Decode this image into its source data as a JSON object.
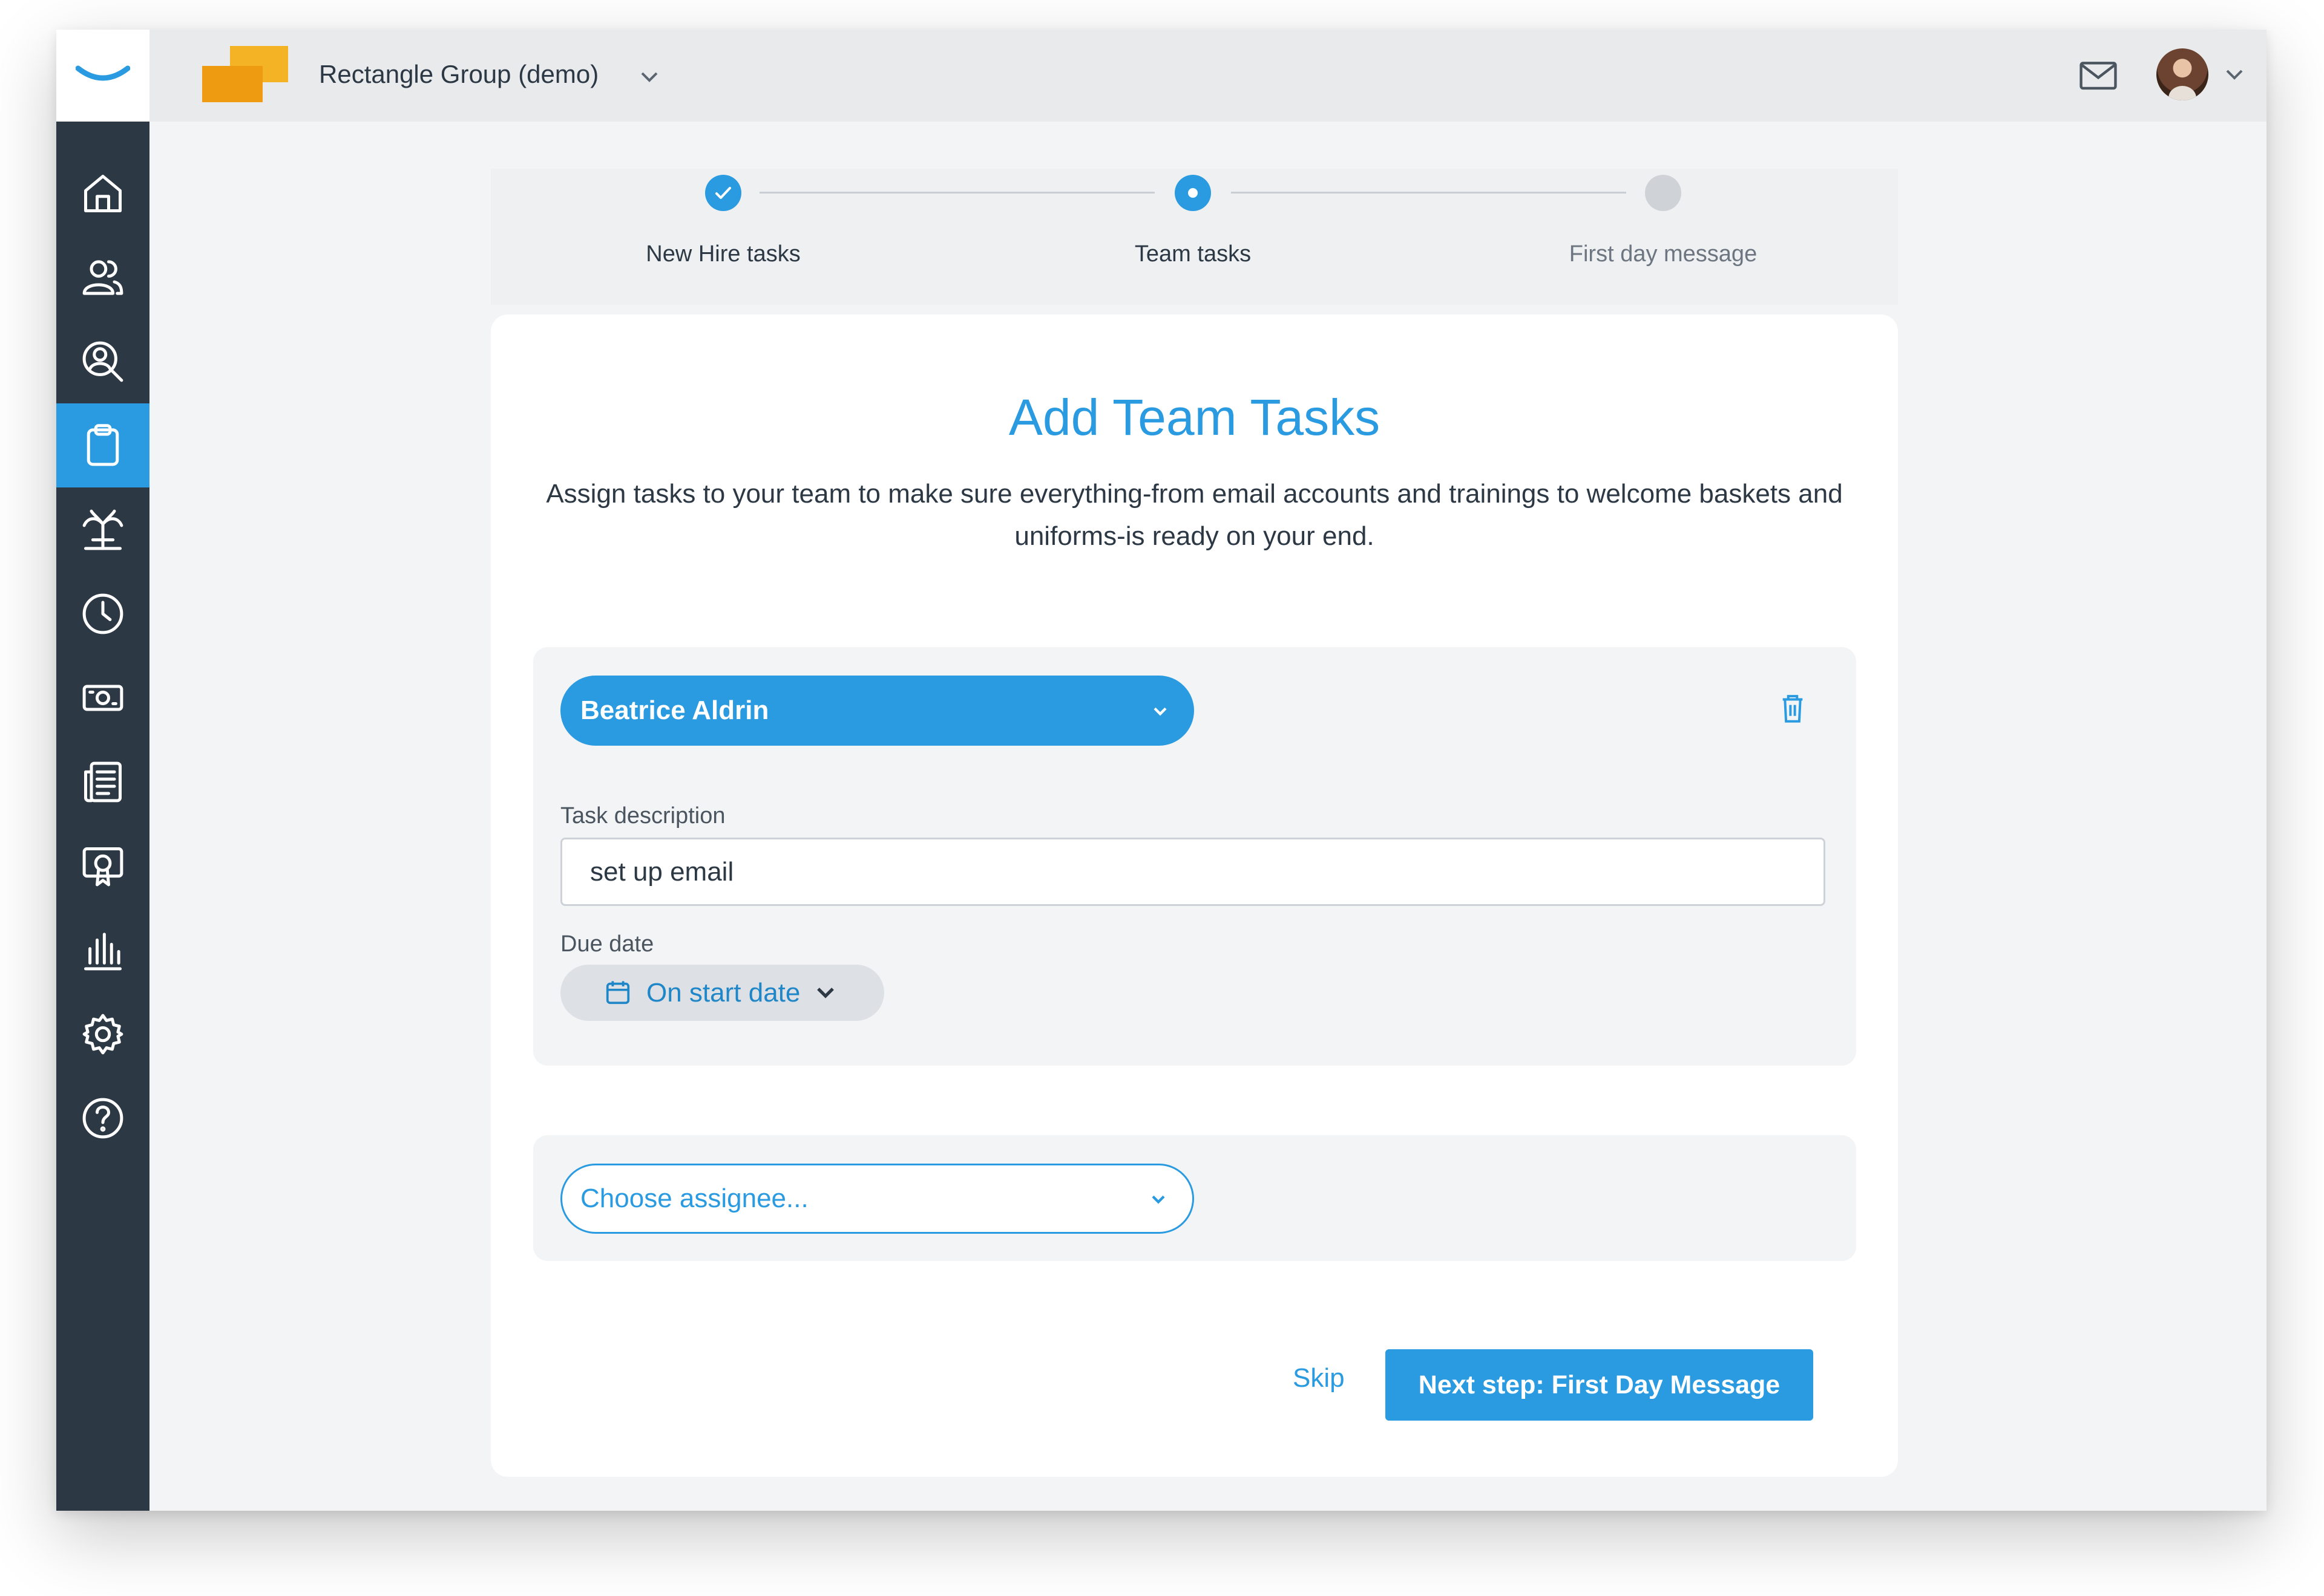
{
  "app": {
    "company_name": "Rectangle Group (demo)",
    "brand_color": "#2a9be0",
    "sidebar_color": "#2d3845"
  },
  "sidebar": {
    "items": [
      {
        "icon": "home-icon",
        "active": false
      },
      {
        "icon": "people-icon",
        "active": false
      },
      {
        "icon": "recruiting-icon",
        "active": false
      },
      {
        "icon": "onboarding-clipboard-icon",
        "active": true
      },
      {
        "icon": "time-off-icon",
        "active": false
      },
      {
        "icon": "clock-icon",
        "active": false
      },
      {
        "icon": "payroll-icon",
        "active": false
      },
      {
        "icon": "documents-icon",
        "active": false
      },
      {
        "icon": "certificate-icon",
        "active": false
      },
      {
        "icon": "reports-icon",
        "active": false
      },
      {
        "icon": "settings-icon",
        "active": false
      },
      {
        "icon": "help-icon",
        "active": false
      }
    ]
  },
  "stepper": {
    "steps": [
      {
        "label": "New Hire tasks",
        "state": "done"
      },
      {
        "label": "Team tasks",
        "state": "current"
      },
      {
        "label": "First day message",
        "state": "todo"
      }
    ]
  },
  "card": {
    "title": "Add Team Tasks",
    "description": "Assign tasks to your team to make sure everything-from email accounts and trainings to welcome baskets and uniforms-is ready on your end."
  },
  "task": {
    "assignee": "Beatrice Aldrin",
    "description_label": "Task description",
    "description_value": "set up email",
    "due_label": "Due date",
    "due_value": "On start date"
  },
  "new_task": {
    "assignee_placeholder": "Choose assignee..."
  },
  "actions": {
    "skip": "Skip",
    "next": "Next step: First Day Message"
  }
}
